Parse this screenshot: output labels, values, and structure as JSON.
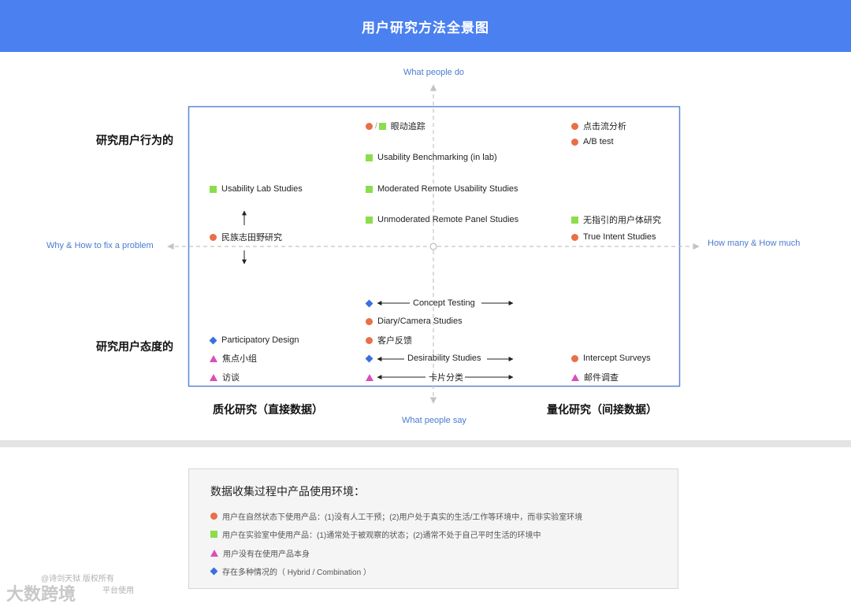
{
  "header": {
    "title": "用户研究方法全景图"
  },
  "axes": {
    "top": "What people do",
    "bottom": "What people say",
    "left": "Why & How to fix a problem",
    "right": "How many & How much"
  },
  "row_labels": {
    "behavior": "研究用户行为的",
    "attitude": "研究用户态度的"
  },
  "column_labels": {
    "qualitative": "质化研究（直接数据）",
    "quantitative": "量化研究（间接数据）"
  },
  "methods": {
    "eye_tracking": "眼动追踪",
    "clickstream": "点击流分析",
    "ab_test": "A/B test",
    "usability_benchmarking": "Usability Benchmarking (in lab)",
    "usability_lab": "Usability Lab Studies",
    "moderated_remote": "Moderated Remote Usability Studies",
    "unmoderated_remote": "Unmoderated Remote Panel Studies",
    "unguided_ux": "无指引的用户体研究",
    "ethnographic": "民族志田野研究",
    "true_intent": "True Intent Studies",
    "concept_testing": "Concept Testing",
    "diary_camera": "Diary/Camera Studies",
    "participatory_design": "Participatory Design",
    "customer_feedback": "客户反馈",
    "focus_group": "焦点小组",
    "desirability": "Desirability Studies",
    "intercept_surveys": "Intercept Surveys",
    "interview": "访谈",
    "card_sorting": "卡片分类",
    "email_survey": "邮件调查"
  },
  "legend": {
    "title": "数据收集过程中产品使用环境：",
    "items": [
      {
        "shape": "circle",
        "text": "用户在自然状态下使用产品：(1)没有人工干预；(2)用户处于真实的生活/工作等环境中，而非实验室环境"
      },
      {
        "shape": "square",
        "text": "用户在实验室中使用产品：(1)通常处于被观察的状态；(2)通常不处于自己平时生活的环境中"
      },
      {
        "shape": "triangle",
        "text": "用户没有在使用产品本身"
      },
      {
        "shape": "diamond",
        "text": "存在多种情况的（ Hybrid / Combination ）"
      }
    ]
  },
  "watermark": {
    "line1": "@诗剑天狱 版权所有",
    "line2": "平台使用",
    "logo": "大数跨境"
  },
  "colors": {
    "header": "#4a80f0",
    "circle": "#e86f48",
    "square": "#8bdd4c",
    "triangle": "#d84fb8",
    "diamond": "#3b6fe0",
    "frame": "#5b87d6"
  }
}
